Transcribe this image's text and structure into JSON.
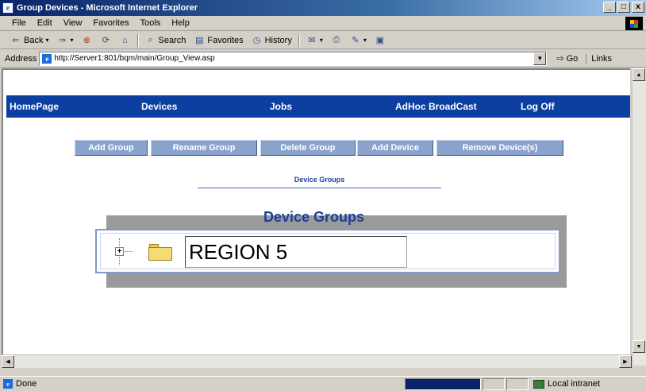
{
  "window": {
    "title": "Group Devices - Microsoft Internet Explorer",
    "min_label": "_",
    "max_label": "□",
    "close_label": "x"
  },
  "menu": [
    "File",
    "Edit",
    "View",
    "Favorites",
    "Tools",
    "Help"
  ],
  "toolbar": {
    "back": "Back",
    "forward": "⇒",
    "search": "Search",
    "favorites": "Favorites",
    "history": "History"
  },
  "address": {
    "label": "Address",
    "url": "http://Server1:801/bqm/main/Group_View.asp",
    "go": "Go",
    "links": "Links"
  },
  "nav": {
    "items": [
      "HomePage",
      "Devices",
      "Jobs",
      "AdHoc BroadCast",
      "Log Off"
    ]
  },
  "actions": [
    "Add Group",
    "Rename Group",
    "Delete Group",
    "Add Device",
    "Remove Device(s)"
  ],
  "subtitle": "Device Groups",
  "panel": {
    "title": "Device Groups",
    "expand_symbol": "+",
    "group_name": "REGION 5"
  },
  "status": {
    "text": "Done",
    "zone": "Local intranet"
  },
  "colors": {
    "nav_bg": "#0c3fa0",
    "button_bg": "#8aa3cc",
    "heading": "#1c3f9a"
  }
}
